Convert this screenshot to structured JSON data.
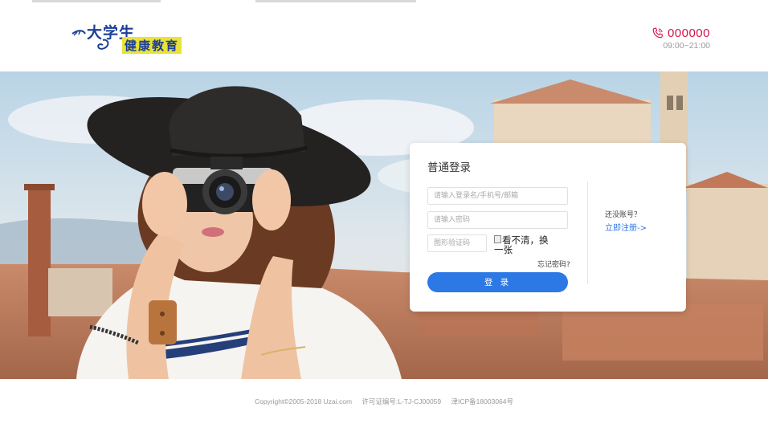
{
  "header": {
    "logo": {
      "line1": "大学生",
      "line2": "健康教育"
    },
    "phone": {
      "number": "000000",
      "hours": "09:00~21:00"
    }
  },
  "login": {
    "title": "普通登录",
    "username_placeholder": "请输入登录名/手机号/邮箱",
    "password_placeholder": "请输入密码",
    "captcha_placeholder": "图形验证码",
    "captcha_alt": "看不清，换一张",
    "forgot_label": "忘记密码?",
    "submit_label": "登 录",
    "no_account_label": "还没账号？",
    "register_label": "立即注册->"
  },
  "footer": {
    "copyright": "Copyright©2005-2018 Uzai.com",
    "license": "许可证编号:L-TJ-CJ00059",
    "icp": "津ICP备18003064号"
  },
  "colors": {
    "accent": "#2c78e4",
    "phone": "#d0154a",
    "logo": "#1c3f96"
  },
  "icons": {
    "phone": "phone-icon",
    "logo_swirl": "logo-swirl-icon",
    "captcha_broken": "broken-image-icon"
  }
}
